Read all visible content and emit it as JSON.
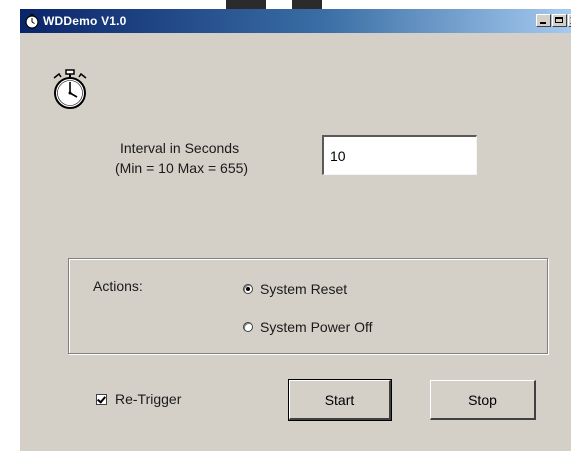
{
  "window": {
    "title": "WDDemo V1.0",
    "close_glyph": "x"
  },
  "interval": {
    "label_line1": "Interval in Seconds",
    "label_line2": "(Min = 10 Max = 655)",
    "value": "10"
  },
  "actions": {
    "label": "Actions:",
    "options": [
      {
        "label": "System Reset",
        "selected": true
      },
      {
        "label": "System Power Off",
        "selected": false
      }
    ]
  },
  "retrigger": {
    "label": "Re-Trigger",
    "checked": true
  },
  "buttons": {
    "start": "Start",
    "stop": "Stop"
  },
  "icons": {
    "app": "stopwatch-icon",
    "main": "stopwatch-icon"
  },
  "colors": {
    "titlebar_start": "#0a246a",
    "titlebar_end": "#a6caf0",
    "face": "#d4d0c8"
  }
}
